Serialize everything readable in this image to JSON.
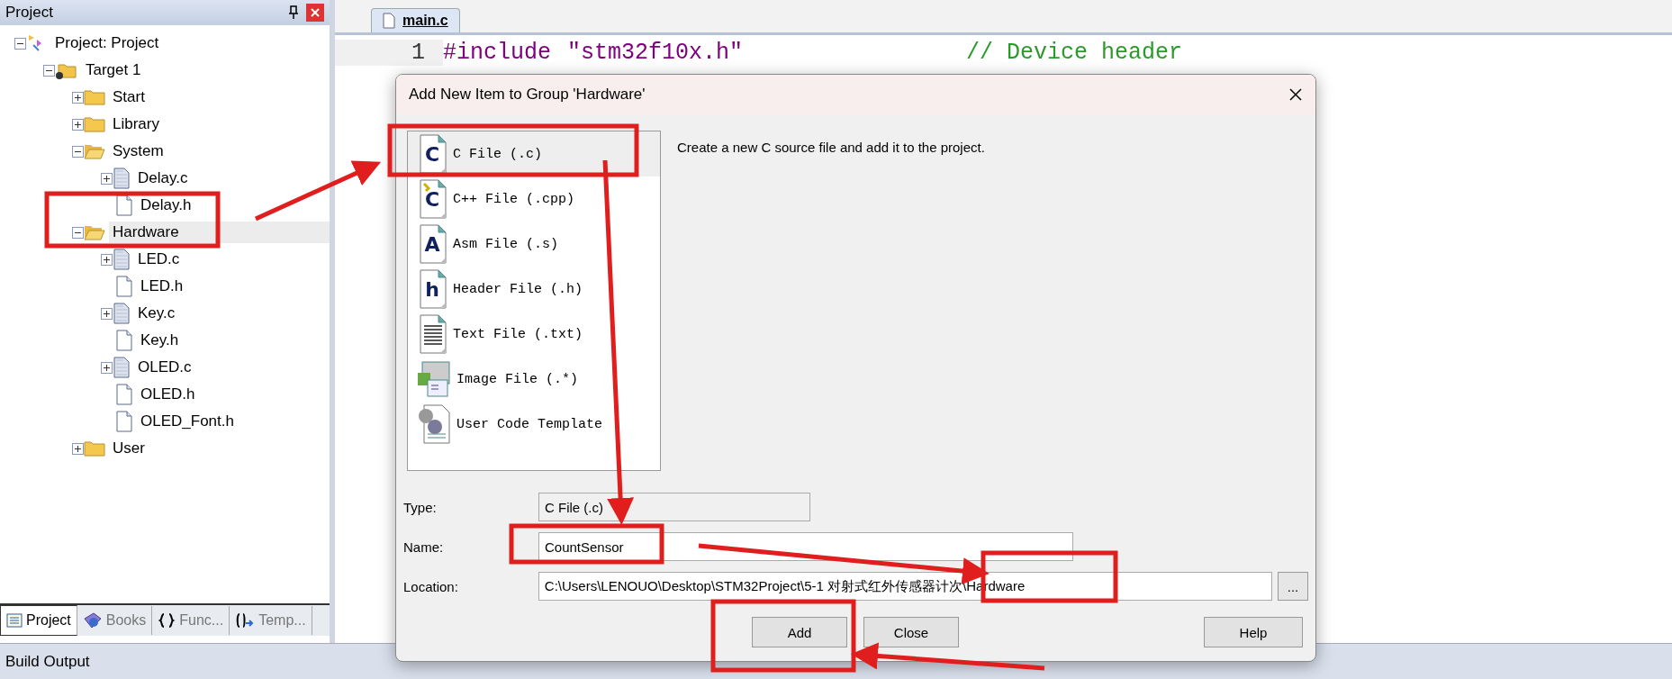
{
  "project_panel": {
    "title": "Project",
    "tree": [
      {
        "label": "Project: Project",
        "kind": "project",
        "expanded": true,
        "selected": false,
        "children": [
          {
            "label": "Target 1",
            "kind": "target",
            "expanded": true,
            "selected": false,
            "children": [
              {
                "label": "Start",
                "kind": "folder",
                "expanded": false,
                "selected": false
              },
              {
                "label": "Library",
                "kind": "folder",
                "expanded": false,
                "selected": false
              },
              {
                "label": "System",
                "kind": "folder",
                "expanded": true,
                "selected": false,
                "children": [
                  {
                    "label": "Delay.c",
                    "kind": "source",
                    "expanded": false,
                    "selected": false
                  },
                  {
                    "label": "Delay.h",
                    "kind": "header",
                    "selected": false
                  }
                ]
              },
              {
                "label": "Hardware",
                "kind": "folder",
                "expanded": true,
                "selected": true,
                "children": [
                  {
                    "label": "LED.c",
                    "kind": "source",
                    "expanded": false,
                    "selected": false
                  },
                  {
                    "label": "LED.h",
                    "kind": "header",
                    "selected": false
                  },
                  {
                    "label": "Key.c",
                    "kind": "source",
                    "expanded": false,
                    "selected": false
                  },
                  {
                    "label": "Key.h",
                    "kind": "header",
                    "selected": false
                  },
                  {
                    "label": "OLED.c",
                    "kind": "source",
                    "expanded": false,
                    "selected": false
                  },
                  {
                    "label": "OLED.h",
                    "kind": "header",
                    "selected": false
                  },
                  {
                    "label": "OLED_Font.h",
                    "kind": "header",
                    "selected": false
                  }
                ]
              },
              {
                "label": "User",
                "kind": "folder",
                "expanded": false,
                "selected": false
              }
            ]
          }
        ]
      }
    ],
    "tabs": [
      {
        "label": "Project",
        "kind": "project",
        "selected": true
      },
      {
        "label": "Books",
        "kind": "books",
        "selected": false
      },
      {
        "label": "Func...",
        "kind": "functions",
        "selected": false
      },
      {
        "label": "Temp...",
        "kind": "templates",
        "selected": false
      }
    ]
  },
  "editor": {
    "tabs": [
      {
        "label": "main.c",
        "selected": true
      }
    ],
    "lines": [
      {
        "number": "1",
        "tokens": [
          {
            "kind": "directive",
            "text": "#include"
          },
          {
            "kind": "string",
            "text": "\"stm32f10x.h\""
          },
          {
            "kind": "comment",
            "text": "// Device header"
          }
        ]
      }
    ]
  },
  "build_output": {
    "title": "Build Output"
  },
  "dialog": {
    "title": "Add New Item to Group 'Hardware'",
    "items": [
      {
        "label": "C File (.c)",
        "kind": "c",
        "glyph": "C",
        "selected": true
      },
      {
        "label": "C++ File (.cpp)",
        "kind": "cpp",
        "glyph": "C",
        "selected": false
      },
      {
        "label": "Asm File (.s)",
        "kind": "asm",
        "glyph": "A",
        "selected": false
      },
      {
        "label": "Header File (.h)",
        "kind": "header",
        "glyph": "h",
        "selected": false
      },
      {
        "label": "Text File (.txt)",
        "kind": "text",
        "selected": false
      },
      {
        "label": "Image File (.*)",
        "kind": "image",
        "selected": false
      },
      {
        "label": "User Code Template",
        "kind": "template",
        "selected": false
      }
    ],
    "description": "Create a new C source file and add it to the project.",
    "fields": [
      {
        "label": "Type:",
        "value": "C File (.c)",
        "disabled": true
      },
      {
        "label": "Name:",
        "value": "CountSensor",
        "disabled": false
      },
      {
        "label": "Location:",
        "value": "C:\\Users\\LENOUO\\Desktop\\STM32Project\\5-1 对射式红外传感器计次\\Hardware",
        "disabled": false,
        "browse": "..."
      }
    ],
    "buttons": [
      {
        "label": "Add",
        "kind": "add"
      },
      {
        "label": "Close",
        "kind": "close"
      },
      {
        "label": "Help",
        "kind": "help"
      }
    ]
  }
}
